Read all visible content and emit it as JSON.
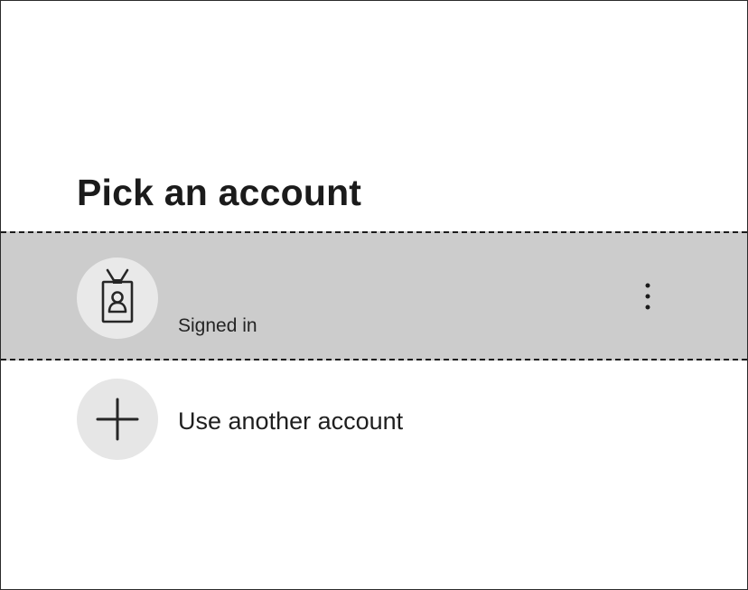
{
  "dialog": {
    "title": "Pick an account",
    "account": {
      "name": "",
      "status": "Signed in",
      "avatar_icon": "id-badge-icon",
      "more_icon": "more-vertical-icon"
    },
    "add_account": {
      "label": "Use another account",
      "icon": "plus-icon"
    }
  }
}
